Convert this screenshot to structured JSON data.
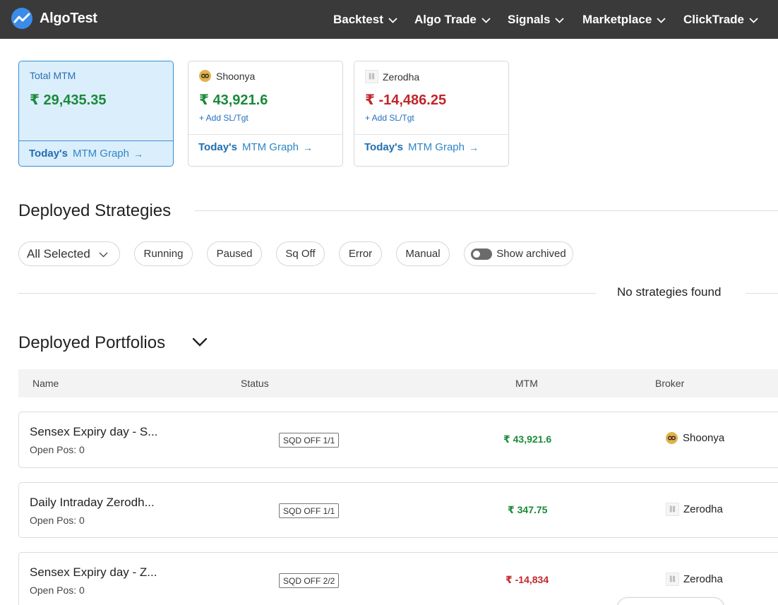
{
  "app": {
    "name": "AlgoTest"
  },
  "nav": {
    "items": [
      {
        "label": "Backtest"
      },
      {
        "label": "Algo Trade"
      },
      {
        "label": "Signals"
      },
      {
        "label": "Marketplace"
      },
      {
        "label": "ClickTrade"
      }
    ]
  },
  "mtm_cards": [
    {
      "title": "Total MTM",
      "value": "₹ 29,435.35",
      "value_color": "#1a8a3a",
      "link_prefix": "Today's",
      "link_label": "MTM Graph"
    },
    {
      "title": "Shoonya",
      "icon": "shoonya-broker-icon",
      "value": "₹ 43,921.6",
      "value_color": "#1a8a3a",
      "add_label": "+ Add SL/Tgt",
      "link_prefix": "Today's",
      "link_label": "MTM Graph"
    },
    {
      "title": "Zerodha",
      "icon": "zerodha-broker-icon",
      "value": "₹ -14,486.25",
      "value_color": "#c0262b",
      "add_label": "+ Add SL/Tgt",
      "link_prefix": "Today's",
      "link_label": "MTM Graph"
    }
  ],
  "strategies": {
    "title": "Deployed Strategies",
    "filter_select": "All Selected",
    "filters": [
      "Running",
      "Paused",
      "Sq Off",
      "Error",
      "Manual"
    ],
    "archived_toggle_label": "Show archived",
    "empty_message": "No strategies found"
  },
  "portfolios": {
    "title": "Deployed Portfolios",
    "columns": [
      "Name",
      "Status",
      "MTM",
      "Broker"
    ],
    "rows": [
      {
        "name": "Sensex Expiry day - S...",
        "sub": "Open Pos: 0",
        "status": "SQD OFF 1/1",
        "mtm": "₹ 43,921.6",
        "mtm_color": "#1a8a3a",
        "broker": "Shoonya",
        "broker_icon": "shoonya-broker-icon"
      },
      {
        "name": "Daily Intraday Zerodh...",
        "sub": "Open Pos: 0",
        "status": "SQD OFF 1/1",
        "mtm": "₹ 347.75",
        "mtm_color": "#1a8a3a",
        "broker": "Zerodha",
        "broker_icon": "zerodha-broker-icon"
      },
      {
        "name": "Sensex Expiry day - Z...",
        "sub": "Open Pos: 0",
        "status": "SQD OFF 2/2",
        "mtm": "₹ -14,834",
        "mtm_color": "#c0262b",
        "broker": "Zerodha",
        "broker_icon": "zerodha-broker-icon"
      }
    ]
  }
}
